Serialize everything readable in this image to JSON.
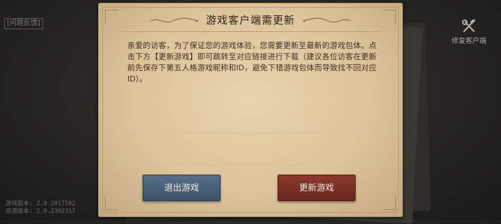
{
  "top_left": {
    "feedback_label": "[问题反馈]"
  },
  "top_right": {
    "repair_label": "修复客户端",
    "repair_icon": "wrench-hammer-icon"
  },
  "dialog": {
    "title": "游戏客户端需更新",
    "message": "亲爱的访客，为了保证您的游戏体验，您需要更新至最新的游戏包体。点击下方【更新游戏】即可跳转至对应链接进行下载（建议各位访客在更新前先保存下第五人格游戏昵称和ID，避免下错游戏包体而导致找不回对应ID）。",
    "exit_button": "退出游戏",
    "update_button": "更新游戏"
  },
  "versions": {
    "game_version": "游戏版本: 2.0.2017582",
    "resource_version": "资源版本: 2.0.2302317"
  },
  "colors": {
    "exit_button": "#4a6079",
    "update_button": "#7a3024",
    "paper": "#dcc49b"
  }
}
